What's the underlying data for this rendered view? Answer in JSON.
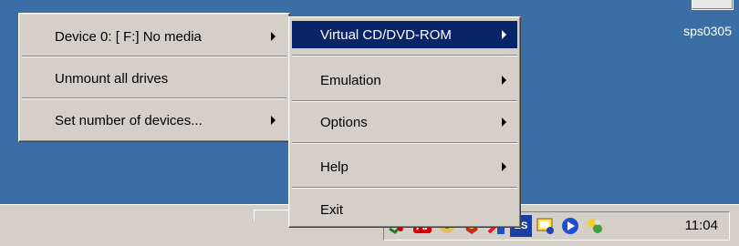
{
  "desktop": {
    "label": "sps0305"
  },
  "menu_left": {
    "items": [
      {
        "label": "Device 0: [ F:] No media",
        "submenu": true
      },
      {
        "label": "Unmount all drives",
        "submenu": false
      },
      {
        "label": "Set number of devices...",
        "submenu": true
      }
    ]
  },
  "menu_main": {
    "items": [
      {
        "label": "Virtual CD/DVD-ROM",
        "submenu": true,
        "selected": true
      },
      {
        "label": "Emulation",
        "submenu": true
      },
      {
        "label": "Options",
        "submenu": true
      },
      {
        "label": "Help",
        "submenu": true
      },
      {
        "label": "Exit",
        "submenu": false
      }
    ]
  },
  "tray": {
    "icons": [
      "network-icon",
      "adobe-icon",
      "hardware-icon",
      "shield-icon",
      "antivirus-icon",
      "language-es-icon",
      "daemon-tools-icon",
      "media-player-icon",
      "antivirus-scan-icon"
    ],
    "language": "ES",
    "clock": "11:04"
  }
}
